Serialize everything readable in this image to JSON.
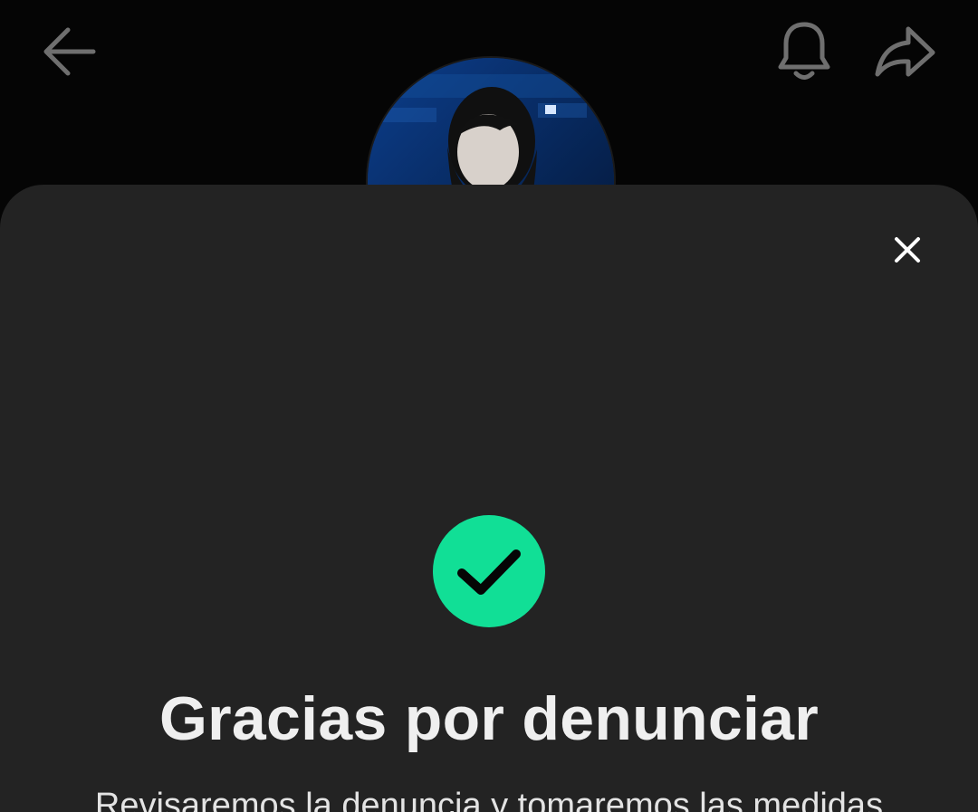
{
  "header": {
    "back_icon": "arrow-left-icon",
    "notification_icon": "bell-icon",
    "share_icon": "share-arrow-icon"
  },
  "profile": {
    "avatar_icon": "profile-avatar-image"
  },
  "dialog": {
    "close_icon": "close-icon",
    "status_icon": "checkmark-icon",
    "title": "Gracias por denunciar",
    "message": "Revisaremos la denuncia y tomaremos las medidas"
  },
  "colors": {
    "background": "#050505",
    "sheet": "#232323",
    "success": "#11df96",
    "text": "#efefef",
    "icon_muted": "#6f6f6f"
  }
}
